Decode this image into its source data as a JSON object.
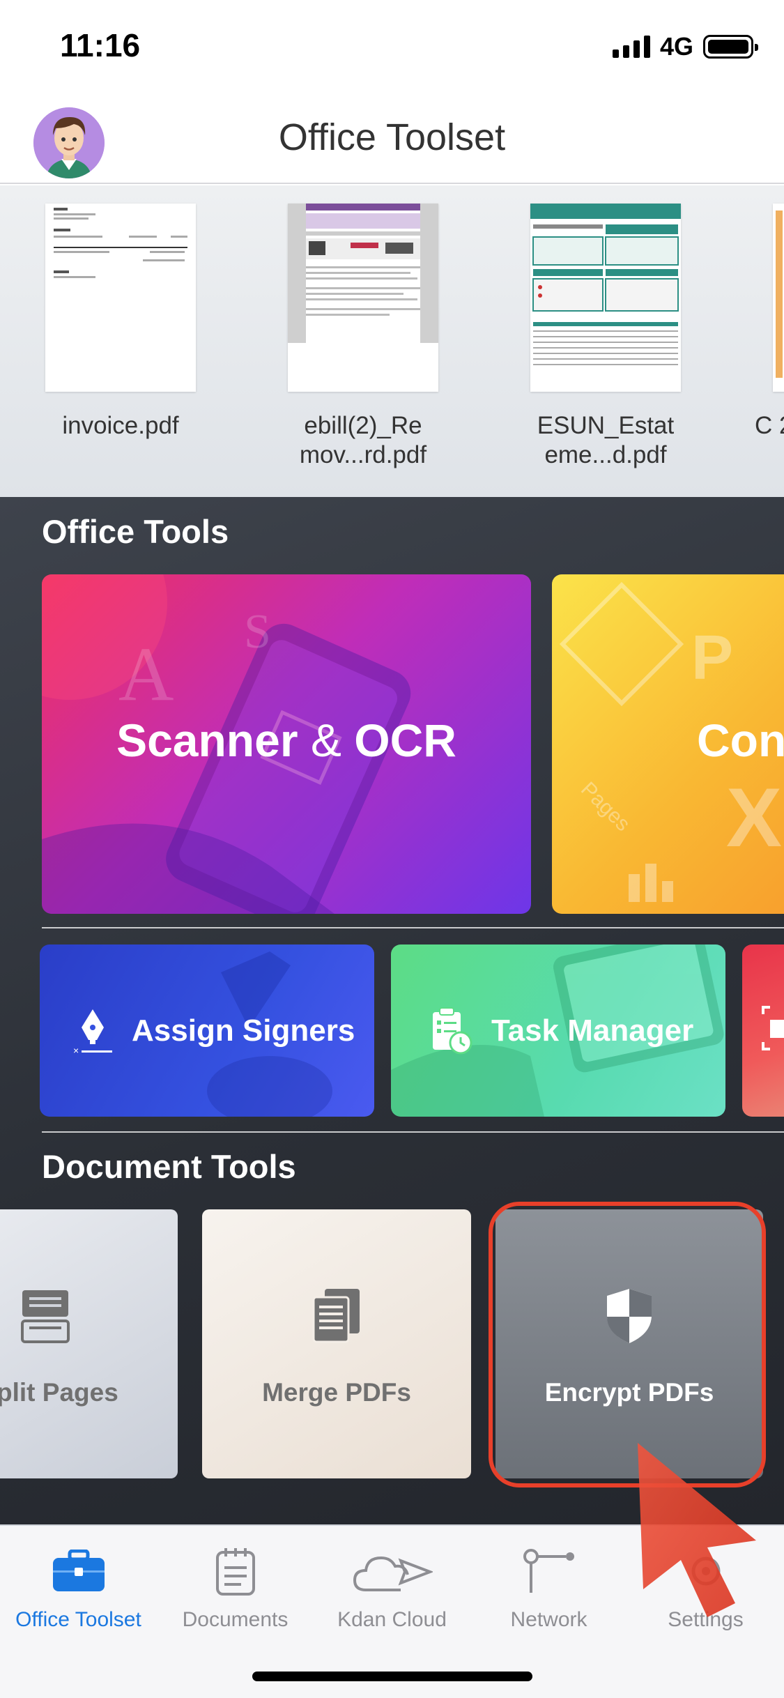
{
  "status_bar": {
    "time": "11:16",
    "network": "4G"
  },
  "header": {
    "title": "Office Toolset"
  },
  "recent_files": [
    {
      "name": "invoice.pdf"
    },
    {
      "name": "ebill(2)_Re mov...rd.pdf"
    },
    {
      "name": "ESUN_Estat eme...d.pdf"
    },
    {
      "name": "C 2"
    }
  ],
  "office_tools": {
    "title": "Office Tools",
    "cards": {
      "scanner": {
        "label_a": "Scanner",
        "label_amp": "&",
        "label_b": "OCR"
      },
      "convert": {
        "label": "Con"
      },
      "assign_signers": {
        "label": "Assign Signers"
      },
      "task_manager": {
        "label": "Task Manager"
      }
    }
  },
  "document_tools": {
    "title": "Document Tools",
    "cards": [
      {
        "label": "plit Pages"
      },
      {
        "label": "Merge PDFs"
      },
      {
        "label": "Encrypt PDFs"
      }
    ]
  },
  "tab_bar": {
    "tabs": [
      {
        "label": "Office Toolset"
      },
      {
        "label": "Documents"
      },
      {
        "label": "Kdan Cloud"
      },
      {
        "label": "Network"
      },
      {
        "label": "Settings"
      }
    ]
  },
  "colors": {
    "accent_blue": "#1b78e0",
    "highlight_red": "#e8402a",
    "dark_background": "#2b2f36"
  },
  "icons": {
    "signal": "cellular-signal-icon",
    "battery": "battery-icon",
    "assign": "pen-nib-sign-icon",
    "task": "clipboard-clock-icon",
    "split": "split-pages-icon",
    "merge": "merge-document-icon",
    "encrypt": "shield-icon",
    "tab_toolset": "briefcase-icon",
    "tab_documents": "notepad-icon",
    "tab_cloud": "cloud-send-icon",
    "tab_network": "network-node-icon",
    "tab_settings": "gear-icon"
  }
}
